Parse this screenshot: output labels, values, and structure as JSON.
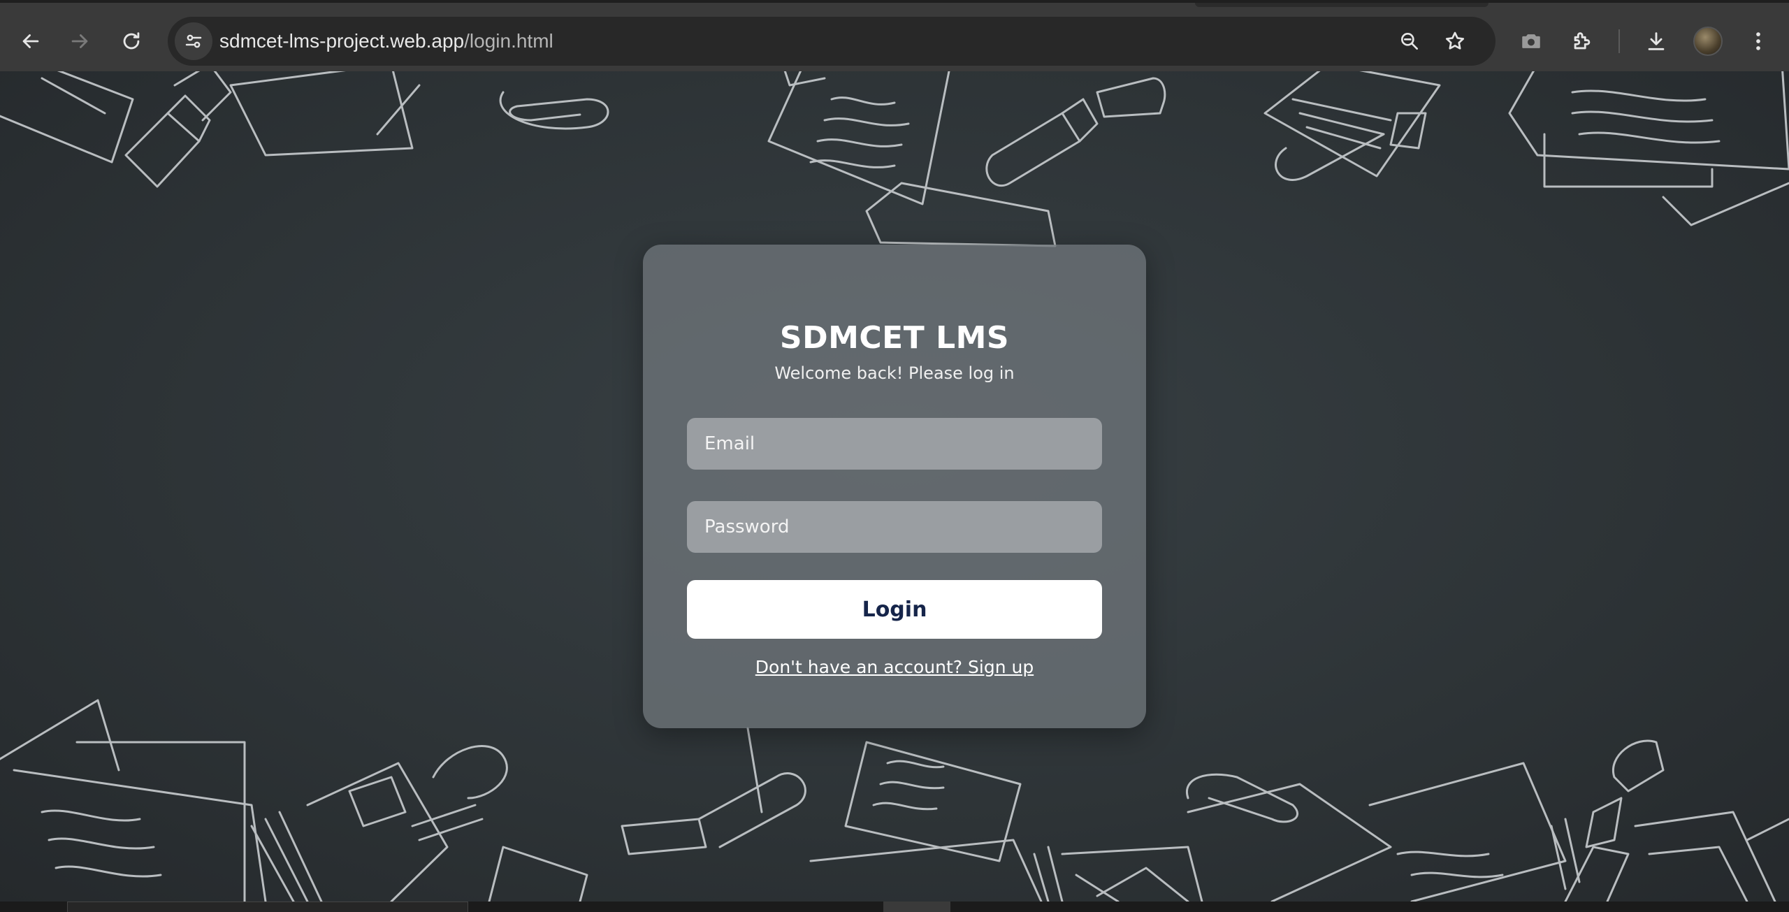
{
  "browser": {
    "url_host": "sdmcet-lms-project.web.app",
    "url_path": "/login.html",
    "icons": {
      "back": "back-arrow-icon",
      "forward": "forward-arrow-icon",
      "reload": "reload-icon",
      "site_info": "tune-icon",
      "zoom": "zoom-out-icon",
      "bookmark": "star-icon",
      "camera": "camera-icon",
      "extensions": "puzzle-icon",
      "downloads": "download-icon",
      "profile": "avatar",
      "menu": "kebab-menu-icon"
    }
  },
  "login": {
    "title": "SDMCET LMS",
    "subtitle": "Welcome back! Please log in",
    "email_placeholder": "Email",
    "password_placeholder": "Password",
    "login_label": "Login",
    "signup_text": "Don't have an account? Sign up"
  },
  "colors": {
    "page_background": "#2d3336",
    "card_background": "#6e747a",
    "input_background": "#9a9ea2",
    "button_background": "#ffffff",
    "button_text": "#16254a"
  }
}
